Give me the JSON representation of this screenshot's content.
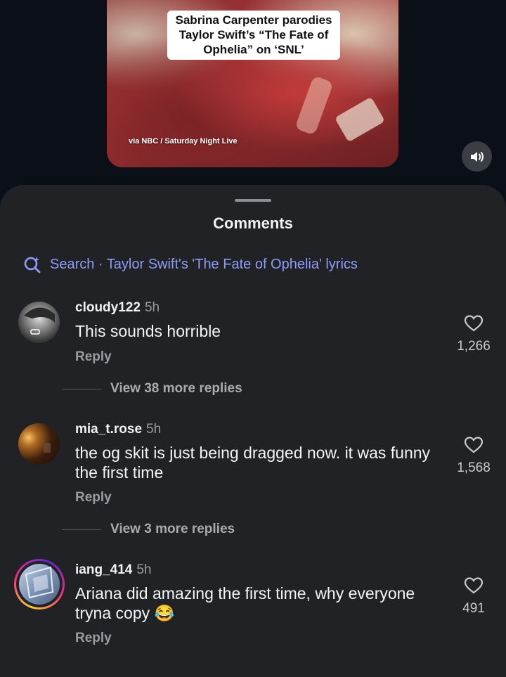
{
  "video": {
    "caption": "Sabrina Carpenter parodies Taylor Swift’s “The Fate of Ophelia” on ‘SNL’",
    "credit": "via NBC / Saturday Night Live"
  },
  "sheet": {
    "title": "Comments",
    "search_text": "Search · Taylor Swift's 'The Fate of Ophelia' lyrics"
  },
  "comments": [
    {
      "username": "cloudy122",
      "time": "5h",
      "text": "This sounds horrible",
      "reply_label": "Reply",
      "likes": "1,266",
      "more_replies": "View 38 more replies"
    },
    {
      "username": "mia_t.rose",
      "time": "5h",
      "text": "the og skit is just being dragged now. it was funny the first time",
      "reply_label": "Reply",
      "likes": "1,568",
      "more_replies": "View 3 more replies"
    },
    {
      "username": "iang_414",
      "time": "5h",
      "text": "Ariana did amazing the first time, why everyone tryna copy 😂",
      "reply_label": "Reply",
      "likes": "491"
    }
  ],
  "colors": {
    "background": "#0b1018",
    "sheet": "#202226",
    "search_accent": "#8f9bf5",
    "story_ring": "#d62976"
  },
  "icons": {
    "sound": "speaker-on-icon",
    "search": "search-sparkle-icon",
    "like": "heart-outline-icon"
  }
}
